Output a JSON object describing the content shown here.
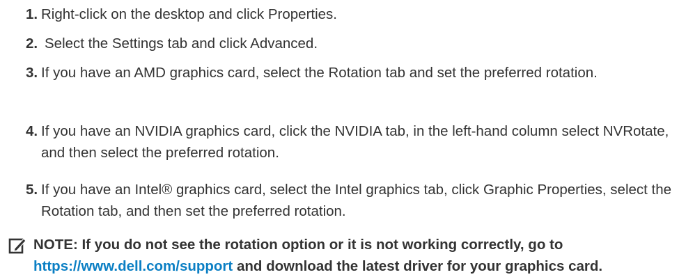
{
  "steps": [
    {
      "number": "1.",
      "text": "Right-click on the desktop and click Properties."
    },
    {
      "number": "2.",
      "text": "Select the Settings tab and click Advanced."
    },
    {
      "number": "3.",
      "text": "If you have an AMD graphics card, select the Rotation tab and set the preferred rotation."
    },
    {
      "number": "4.",
      "text": "If you have an NVIDIA graphics card, click the NVIDIA tab, in the left-hand column select NVRotate, and then select the preferred rotation."
    },
    {
      "number": "5.",
      "text": "If you have an Intel® graphics card, select the Intel graphics tab, click Graphic Properties, select the Rotation tab, and then set the preferred rotation."
    }
  ],
  "note": {
    "icon": "note-pencil-icon",
    "prefix": "NOTE: If you do not see the rotation option or it is not working correctly, go to ",
    "link": "https://www.dell.com/support",
    "suffix": " and download the latest driver for your graphics card.",
    "link_color": "#0b7fc4"
  }
}
